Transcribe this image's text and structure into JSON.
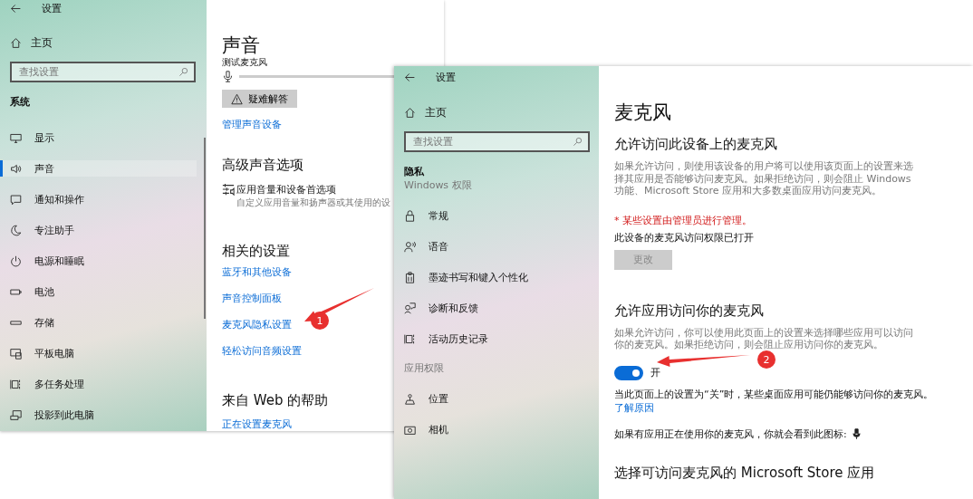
{
  "sound_window": {
    "title": "设置",
    "home": "主页",
    "search": {
      "placeholder": "查找设置"
    },
    "section": "系统",
    "items": [
      {
        "label": "显示",
        "selected": false
      },
      {
        "label": "声音",
        "selected": true
      },
      {
        "label": "通知和操作",
        "selected": false
      },
      {
        "label": "专注助手",
        "selected": false
      },
      {
        "label": "电源和睡眠",
        "selected": false
      },
      {
        "label": "电池",
        "selected": false
      },
      {
        "label": "存储",
        "selected": false
      },
      {
        "label": "平板电脑",
        "selected": false
      },
      {
        "label": "多任务处理",
        "selected": false
      },
      {
        "label": "投影到此电脑",
        "selected": false
      }
    ],
    "heading": "声音",
    "mic_test_label": "测试麦克风",
    "troubleshoot_button": "疑难解答",
    "manage_link": "管理声音设备",
    "advanced_heading": "高级声音选项",
    "advanced_item": {
      "title": "应用音量和设备首选项",
      "subtitle": "自定义应用音量和扬声器或其使用的设"
    },
    "related_heading": "相关的设置",
    "related_links": [
      "蓝牙和其他设备",
      "声音控制面板",
      "麦克风隐私设置",
      "轻松访问音频设置"
    ],
    "help_heading": "来自 Web 的帮助",
    "help_links": [
      "正在设置麦克风"
    ],
    "callout": {
      "label": "1"
    }
  },
  "microphone_window": {
    "title": "设置",
    "home": "主页",
    "search": {
      "placeholder": "查找设置"
    },
    "section": "隐私",
    "groups": [
      {
        "label": "Windows 权限",
        "items": [
          {
            "label": "常规",
            "selected": false
          },
          {
            "label": "语音",
            "selected": false
          },
          {
            "label": "墨迹书写和键入个性化",
            "selected": false
          },
          {
            "label": "诊断和反馈",
            "selected": false
          },
          {
            "label": "活动历史记录",
            "selected": false
          }
        ]
      },
      {
        "label": "应用权限",
        "items": [
          {
            "label": "位置",
            "selected": false
          },
          {
            "label": "相机",
            "selected": false
          }
        ]
      }
    ],
    "heading": "麦克风",
    "device_heading": "允许访问此设备上的麦克风",
    "device_description": "如果允许访问，则使用该设备的用户将可以使用该页面上的设置来选择其应用是否能够访问麦克风。如果拒绝访问，则会阻止 Windows 功能、Microsoft Store 应用和大多数桌面应用访问麦克风。",
    "admin_note": "* 某些设置由管理员进行管理。",
    "device_status": "此设备的麦克风访问权限已打开",
    "change_button": {
      "label": "更改",
      "disabled": true
    },
    "apps_heading": "允许应用访问你的麦克风",
    "apps_description": "如果允许访问，你可以使用此页面上的设置来选择哪些应用可以访问你的麦克风。如果拒绝访问，则会阻止应用访问你的麦克风。",
    "toggle": {
      "label": "开",
      "on": true
    },
    "desktop_note": "当此页面上的设置为“关”时，某些桌面应用可能仍能够访问你的麦克风。",
    "learn_link": "了解原因",
    "icon_note": "如果有应用正在使用你的麦克风，你就会看到此图标:",
    "store_heading": "选择可访问麦克风的 Microsoft Store 应用",
    "callout": {
      "label": "2"
    }
  }
}
